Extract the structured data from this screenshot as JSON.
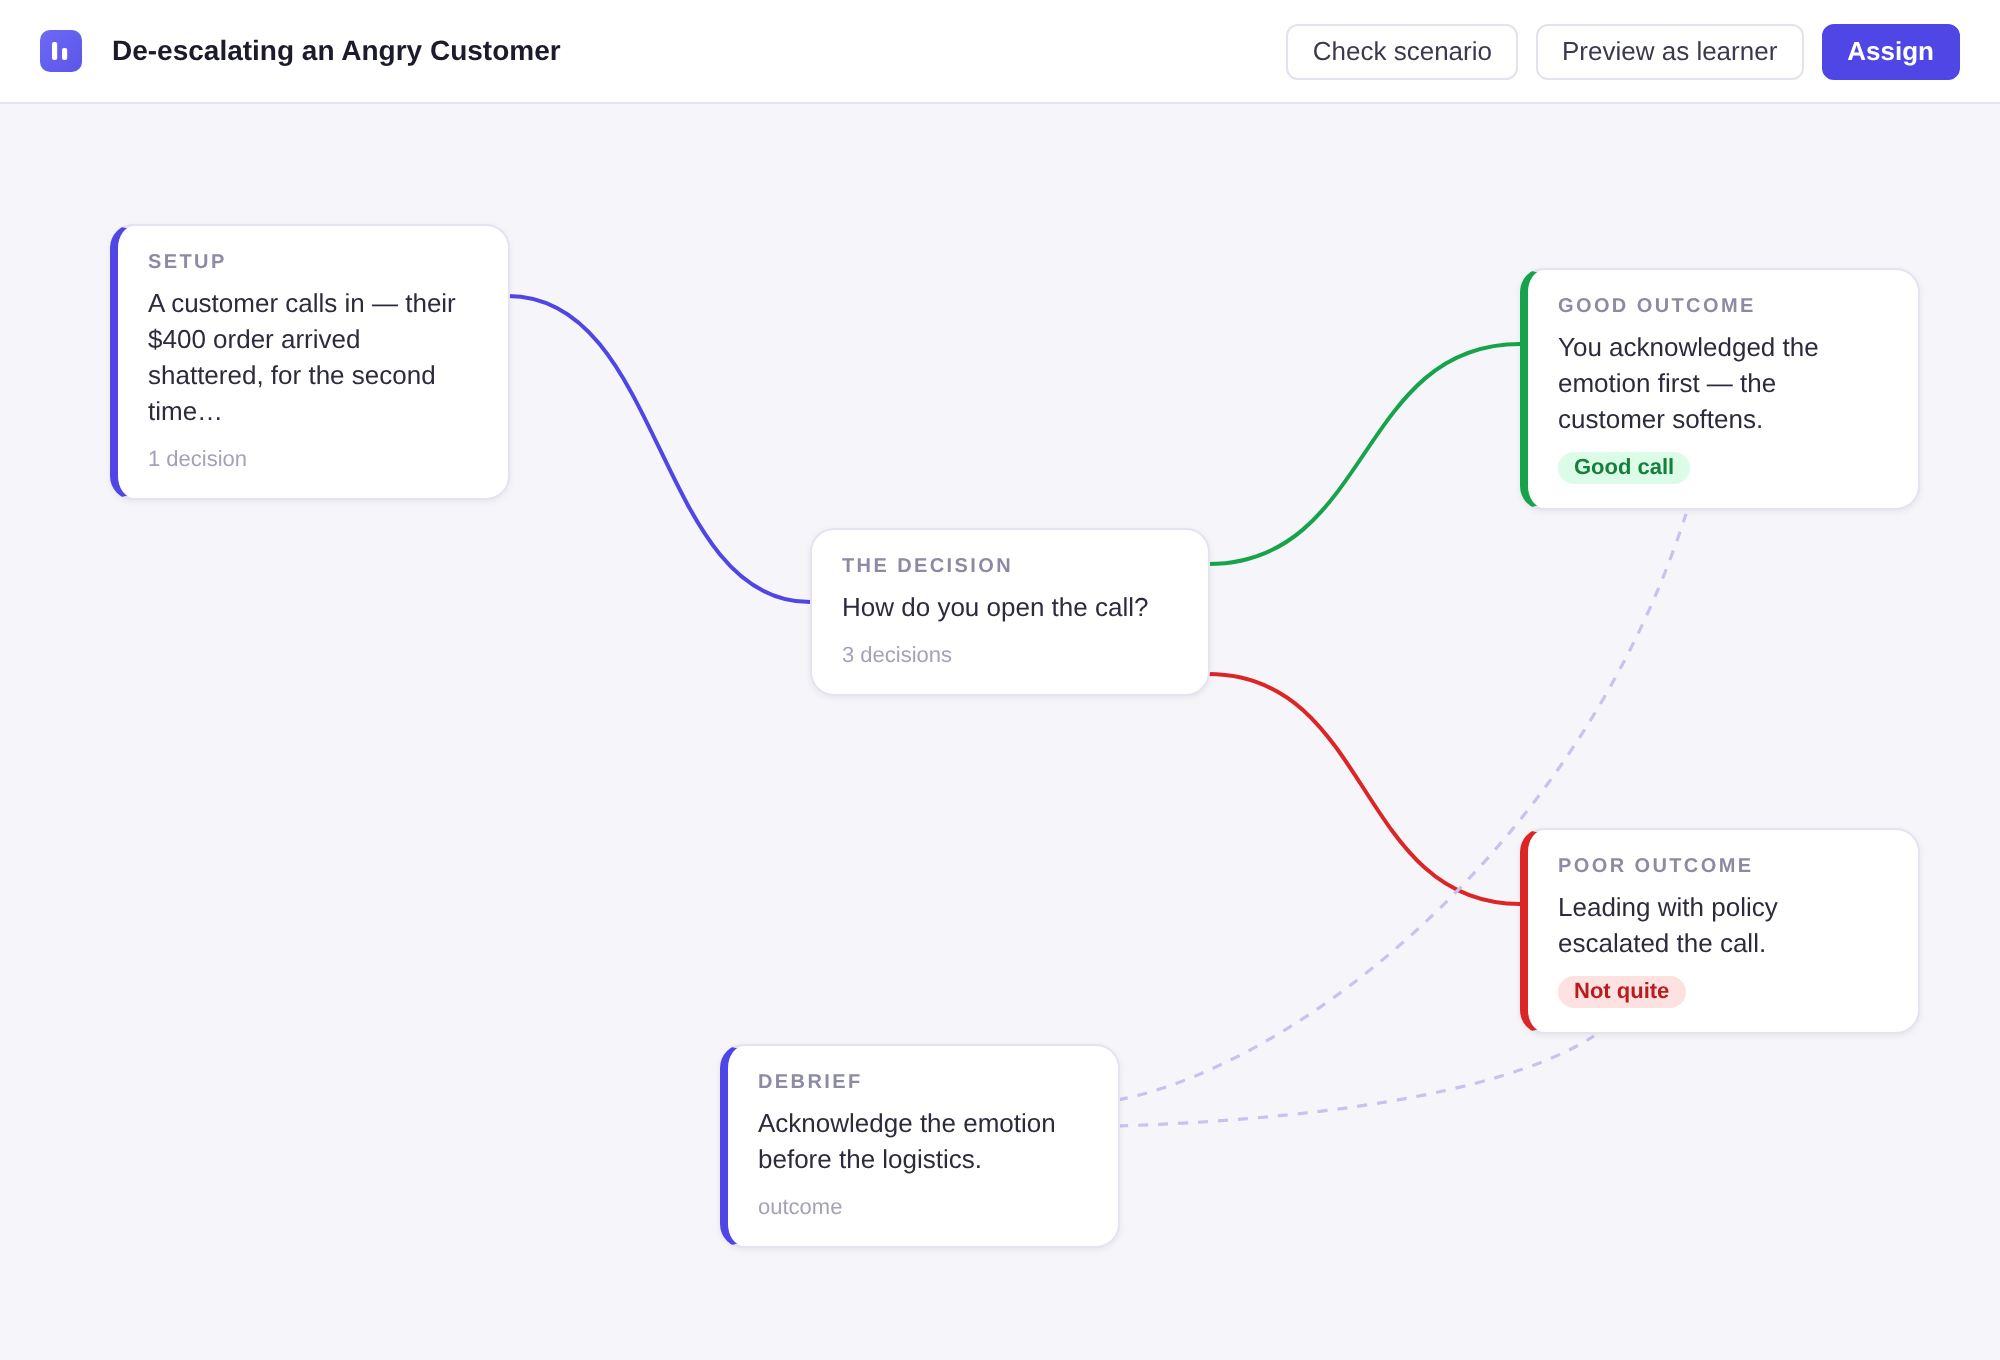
{
  "header": {
    "title": "De-escalating an Angry Customer",
    "buttons": [
      {
        "label": "Check scenario",
        "kind": "secondary"
      },
      {
        "label": "Preview as learner",
        "kind": "secondary"
      },
      {
        "label": "Assign",
        "kind": "primary"
      }
    ]
  },
  "canvas": {
    "nodes": [
      {
        "label": "SETUP",
        "text": "A customer calls in — their $400 order arrived shattered, for the second time…",
        "footer": "1 decision",
        "color": "#4f46e5"
      },
      {
        "label": "THE DECISION",
        "text": "How do you open the call?",
        "footer": "3 decisions"
      },
      {
        "label": "GOOD OUTCOME",
        "text": "You acknowledged the emotion first — the customer softens.",
        "badge": {
          "label": "Good call",
          "kind": "success"
        },
        "color": "#16a34a"
      },
      {
        "label": "POOR OUTCOME",
        "text": "Leading with policy escalated the call.",
        "badge": {
          "label": "Not quite",
          "kind": "danger"
        },
        "color": "#dc2626"
      },
      {
        "label": "DEBRIEF",
        "text": "Acknowledge the emotion before the logistics.",
        "footer": "outcome",
        "color": "#4f46e5"
      }
    ],
    "edges": [
      {
        "kind": "solid",
        "color": "#4f46e5"
      },
      {
        "kind": "solid",
        "color": "#16a34a"
      },
      {
        "kind": "solid",
        "color": "#dc2626"
      },
      {
        "kind": "dashed",
        "color": "#c7c2f0"
      },
      {
        "kind": "dashed",
        "color": "#c7c2f0"
      }
    ]
  }
}
